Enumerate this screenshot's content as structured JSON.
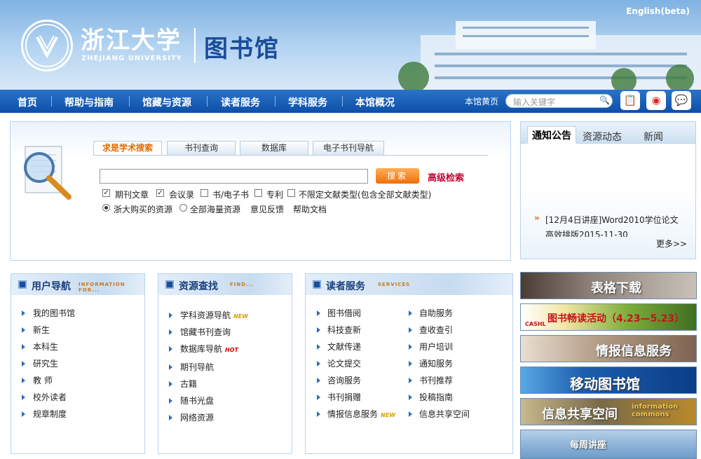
{
  "header": {
    "university_cn": "浙江大学",
    "university_en": "ZHEJIANG UNIVERSITY",
    "library_name": "图书馆",
    "english_link": "English(beta)"
  },
  "nav": {
    "items": [
      "首页",
      "帮助与指南",
      "馆藏与资源",
      "读者服务",
      "学科服务",
      "本馆概况"
    ],
    "yellow_pages": "本馆黄页",
    "search_placeholder": "输入关键字"
  },
  "search": {
    "tabs": [
      "求是学术搜索",
      "书刊查询",
      "数据库",
      "电子书刊导航"
    ],
    "button": "搜索",
    "advanced": "高级检索",
    "checkboxes": [
      {
        "label": "期刊文章",
        "checked": true
      },
      {
        "label": "会议录",
        "checked": true
      },
      {
        "label": "书/电子书",
        "checked": false
      },
      {
        "label": "专利",
        "checked": false
      },
      {
        "label": "不限定文献类型(包含全部文献类型)",
        "checked": false
      }
    ],
    "radios": [
      {
        "label": "浙大购买的资源",
        "checked": true
      },
      {
        "label": "全部海量资源",
        "checked": false
      }
    ],
    "links": [
      "意见反馈",
      "帮助文档"
    ]
  },
  "notice": {
    "tabs": [
      "通知公告",
      "资源动态",
      "新闻"
    ],
    "item": "[12月4日讲座]Word2010学位论文高效排版2015-11-30",
    "more": "更多>>"
  },
  "boxes": {
    "user_nav": {
      "title": "用户导航",
      "subtitle": "INFORMATION FOR...",
      "items": [
        "我的图书馆",
        "新生",
        "本科生",
        "研究生",
        "教 师",
        "校外读者",
        "规章制度"
      ]
    },
    "resources": {
      "title": "资源查找",
      "subtitle": "FIND...",
      "items": [
        "学科资源导航",
        "馆藏书刊查询",
        "数据库导航",
        "期刊导航",
        "古籍",
        "随书光盘",
        "网络资源"
      ],
      "badges": [
        "NEW",
        "",
        "HOT",
        "",
        "",
        "",
        ""
      ]
    },
    "services": {
      "title": "读者服务",
      "subtitle": "SERVICES",
      "col1": [
        "图书借阅",
        "科技查新",
        "文献传递",
        "论文提交",
        "咨询服务",
        "书刊捐赠",
        "情报信息服务"
      ],
      "col1_badge": "NEW",
      "col2": [
        "自助服务",
        "查收查引",
        "用户培训",
        "通知服务",
        "书刊推荐",
        "投稿指南",
        "信息共享空间"
      ]
    }
  },
  "banners": [
    "表格下载",
    "图书畅读活动（4.23—5.23）",
    "CASHL",
    "情报信息服务",
    "移动图书馆",
    "信息共享空间",
    "information commons",
    "每周讲座"
  ]
}
